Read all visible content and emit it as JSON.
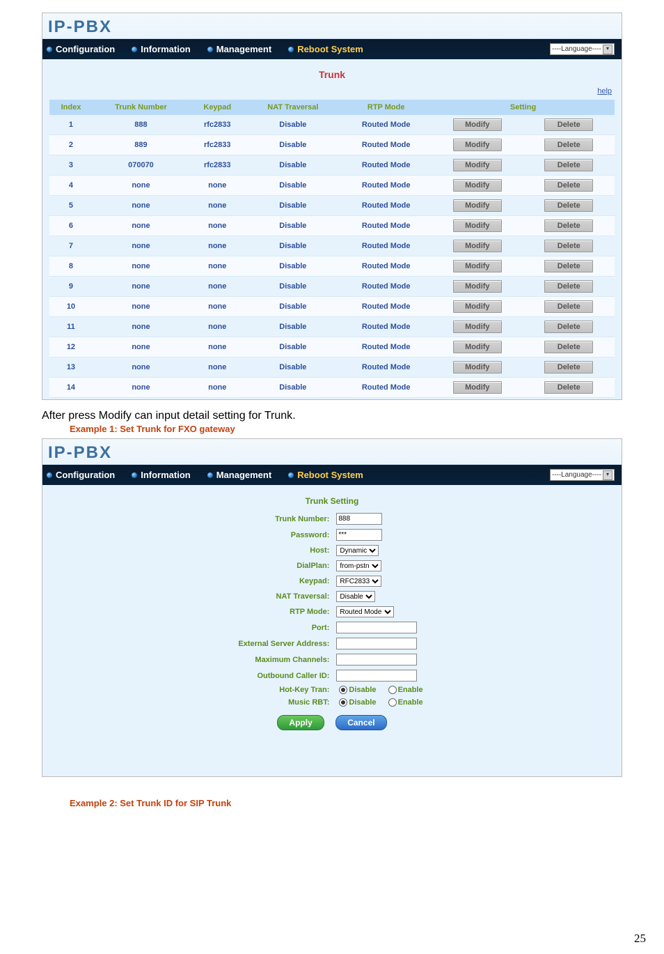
{
  "pagenum": "25",
  "logo": "IP-PBX",
  "nav": {
    "configuration": "Configuration",
    "information": "Information",
    "management": "Management",
    "reboot": "Reboot System",
    "language": "----Language----"
  },
  "trunk": {
    "title": "Trunk",
    "help": "help",
    "headers": {
      "index": "Index",
      "num": "Trunk Number",
      "keypad": "Keypad",
      "nat": "NAT Traversal",
      "rtp": "RTP Mode",
      "setting": "Setting"
    },
    "btn": {
      "modify": "Modify",
      "delete": "Delete"
    },
    "rows": [
      {
        "idx": "1",
        "num": "888",
        "keypad": "rfc2833",
        "nat": "Disable",
        "rtp": "Routed Mode"
      },
      {
        "idx": "2",
        "num": "889",
        "keypad": "rfc2833",
        "nat": "Disable",
        "rtp": "Routed Mode"
      },
      {
        "idx": "3",
        "num": "070070",
        "keypad": "rfc2833",
        "nat": "Disable",
        "rtp": "Routed Mode"
      },
      {
        "idx": "4",
        "num": "none",
        "keypad": "none",
        "nat": "Disable",
        "rtp": "Routed Mode"
      },
      {
        "idx": "5",
        "num": "none",
        "keypad": "none",
        "nat": "Disable",
        "rtp": "Routed Mode"
      },
      {
        "idx": "6",
        "num": "none",
        "keypad": "none",
        "nat": "Disable",
        "rtp": "Routed Mode"
      },
      {
        "idx": "7",
        "num": "none",
        "keypad": "none",
        "nat": "Disable",
        "rtp": "Routed Mode"
      },
      {
        "idx": "8",
        "num": "none",
        "keypad": "none",
        "nat": "Disable",
        "rtp": "Routed Mode"
      },
      {
        "idx": "9",
        "num": "none",
        "keypad": "none",
        "nat": "Disable",
        "rtp": "Routed Mode"
      },
      {
        "idx": "10",
        "num": "none",
        "keypad": "none",
        "nat": "Disable",
        "rtp": "Routed Mode"
      },
      {
        "idx": "11",
        "num": "none",
        "keypad": "none",
        "nat": "Disable",
        "rtp": "Routed Mode"
      },
      {
        "idx": "12",
        "num": "none",
        "keypad": "none",
        "nat": "Disable",
        "rtp": "Routed Mode"
      },
      {
        "idx": "13",
        "num": "none",
        "keypad": "none",
        "nat": "Disable",
        "rtp": "Routed Mode"
      },
      {
        "idx": "14",
        "num": "none",
        "keypad": "none",
        "nat": "Disable",
        "rtp": "Routed Mode"
      }
    ]
  },
  "caption": "After press Modify can input detail setting for Trunk.",
  "example1": "Example 1: Set Trunk for FXO gateway",
  "example2": "Example 2: Set Trunk ID for SIP Trunk",
  "ts": {
    "title": "Trunk Setting",
    "labels": {
      "tn": "Trunk Number:",
      "pw": "Password:",
      "host": "Host:",
      "dp": "DialPlan:",
      "kp": "Keypad:",
      "nat": "NAT Traversal:",
      "rtp": "RTP Mode:",
      "port": "Port:",
      "esa": "External Server Address:",
      "mc": "Maximum Channels:",
      "oc": "Outbound Caller ID:",
      "hk": "Hot-Key Tran:",
      "mr": "Music RBT:"
    },
    "vals": {
      "tn": "888",
      "pw": "***",
      "host": "Dynamic",
      "dp": "from-pstn",
      "kp": "RFC2833",
      "nat": "Disable",
      "rtp": "Routed Mode",
      "port": "",
      "esa": "",
      "mc": "",
      "oc": "",
      "disable": "Disable",
      "enable": "Enable"
    },
    "btn": {
      "apply": "Apply",
      "cancel": "Cancel"
    }
  }
}
